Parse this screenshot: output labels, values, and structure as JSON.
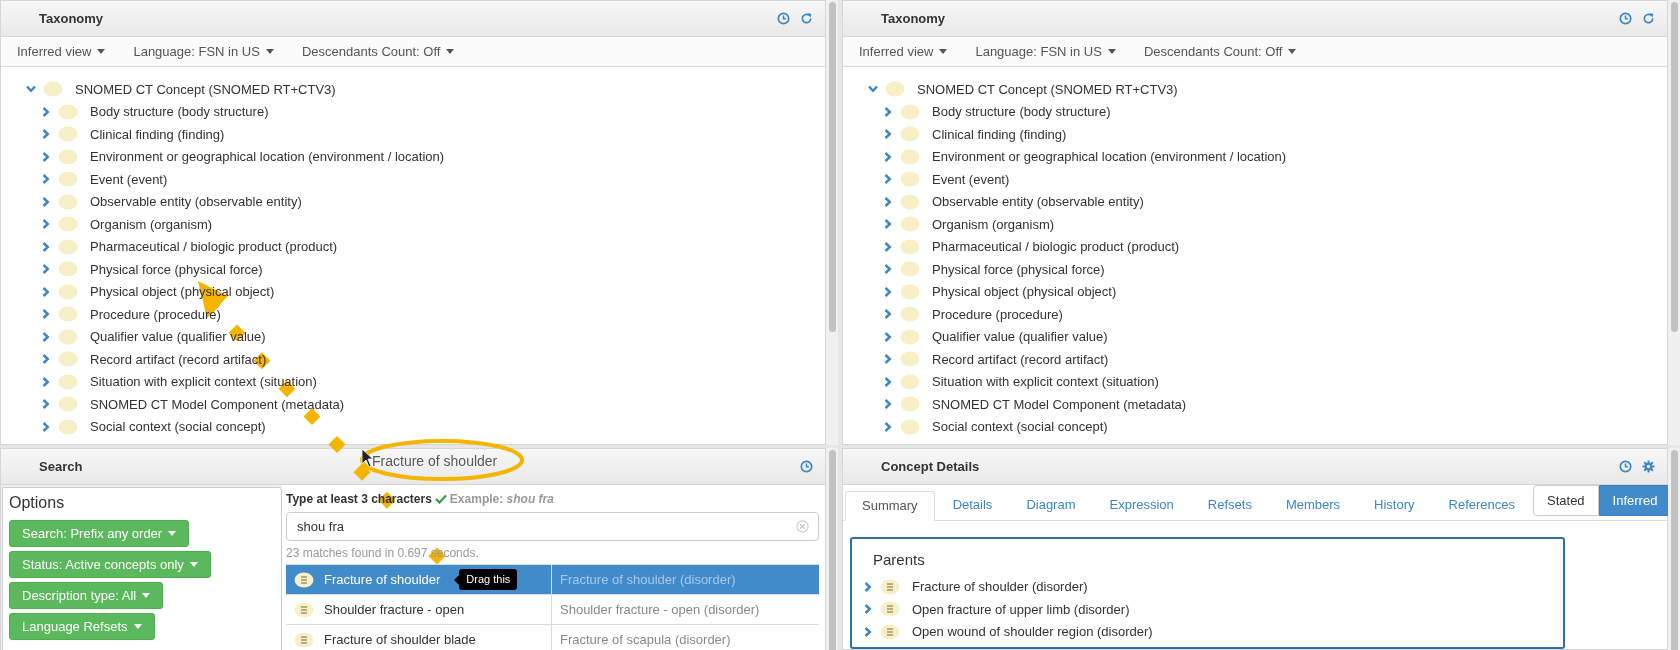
{
  "taxonomy_panels": [
    {
      "title": "Taxonomy",
      "toolbar": [
        "Inferred view",
        "Language: FSN in US",
        "Descendants Count: Off"
      ],
      "tree": {
        "label": "SNOMED CT Concept (SNOMED RT+CTV3)",
        "expanded": true,
        "children": [
          {
            "label": "Body structure (body structure)",
            "expanded": false
          },
          {
            "label": "Clinical finding (finding)",
            "expanded": false
          },
          {
            "label": "Environment or geographical location (environment / location)",
            "expanded": false
          },
          {
            "label": "Event (event)",
            "expanded": false
          },
          {
            "label": "Observable entity (observable entity)",
            "expanded": false
          },
          {
            "label": "Organism (organism)",
            "expanded": false
          },
          {
            "label": "Pharmaceutical / biologic product (product)",
            "expanded": false
          },
          {
            "label": "Physical force (physical force)",
            "expanded": false
          },
          {
            "label": "Physical object (physical object)",
            "expanded": false
          },
          {
            "label": "Procedure (procedure)",
            "expanded": false
          },
          {
            "label": "Qualifier value (qualifier value)",
            "expanded": false
          },
          {
            "label": "Record artifact (record artifact)",
            "expanded": false
          },
          {
            "label": "Situation with explicit context (situation)",
            "expanded": false
          },
          {
            "label": "SNOMED CT Model Component (metadata)",
            "expanded": false
          },
          {
            "label": "Social context (social concept)",
            "expanded": false
          }
        ]
      }
    },
    {
      "title": "Taxonomy",
      "toolbar": [
        "Inferred view",
        "Language: FSN in US",
        "Descendants Count: Off"
      ],
      "tree": {
        "label": "SNOMED CT Concept (SNOMED RT+CTV3)",
        "expanded": true,
        "children": [
          {
            "label": "Body structure (body structure)",
            "expanded": false
          },
          {
            "label": "Clinical finding (finding)",
            "expanded": false
          },
          {
            "label": "Environment or geographical location (environment / location)",
            "expanded": false
          },
          {
            "label": "Event (event)",
            "expanded": false
          },
          {
            "label": "Observable entity (observable entity)",
            "expanded": false
          },
          {
            "label": "Organism (organism)",
            "expanded": false
          },
          {
            "label": "Pharmaceutical / biologic product (product)",
            "expanded": false
          },
          {
            "label": "Physical force (physical force)",
            "expanded": false
          },
          {
            "label": "Physical object (physical object)",
            "expanded": false
          },
          {
            "label": "Procedure (procedure)",
            "expanded": false
          },
          {
            "label": "Qualifier value (qualifier value)",
            "expanded": false
          },
          {
            "label": "Record artifact (record artifact)",
            "expanded": false
          },
          {
            "label": "Situation with explicit context (situation)",
            "expanded": false
          },
          {
            "label": "SNOMED CT Model Component (metadata)",
            "expanded": false
          },
          {
            "label": "Social context (social concept)",
            "expanded": false
          }
        ]
      }
    }
  ],
  "search": {
    "title": "Search",
    "options_title": "Options",
    "option_buttons": [
      "Search: Prefix any order",
      "Status: Active concepts only",
      "Description type: All",
      "Language Refsets"
    ],
    "hint": "Type at least 3 characters",
    "example": "Example: *shou fra*",
    "query": "shou fra",
    "summary": "23 matches found in 0.697 seconds.",
    "results": [
      {
        "term": "Fracture of shoulder",
        "fsn": "Fracture of shoulder (disorder)",
        "selected": true
      },
      {
        "term": "Shoulder fracture - open",
        "fsn": "Shoulder fracture - open (disorder)",
        "selected": false
      },
      {
        "term": "Fracture of shoulder blade",
        "fsn": "Fracture of scapula (disorder)",
        "selected": false
      }
    ],
    "tooltip": "Drag this"
  },
  "concept_details": {
    "title": "Concept Details",
    "tabs": [
      {
        "label": "Summary",
        "selected": true
      },
      {
        "label": "Details",
        "selected": false
      },
      {
        "label": "Diagram",
        "selected": false
      },
      {
        "label": "Expression",
        "selected": false
      },
      {
        "label": "Refsets",
        "selected": false
      },
      {
        "label": "Members",
        "selected": false
      },
      {
        "label": "History",
        "selected": false
      },
      {
        "label": "References",
        "selected": false
      }
    ],
    "view_toggle": [
      {
        "label": "Stated",
        "selected": false
      },
      {
        "label": "Inferred",
        "selected": true
      }
    ],
    "parents_title": "Parents",
    "parents": [
      "Fracture of shoulder (disorder)",
      "Open fracture of upper limb (disorder)",
      "Open wound of shoulder region (disorder)"
    ]
  },
  "drag_annotation": {
    "label": "Fracture of shoulder"
  }
}
